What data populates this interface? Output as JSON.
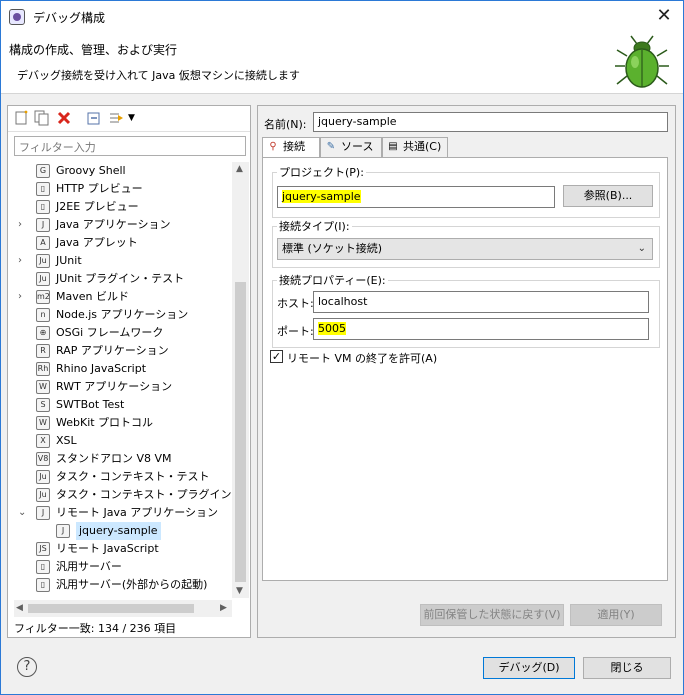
{
  "window": {
    "title": "デバッグ構成",
    "close_glyph": "✕"
  },
  "header": {
    "title": "構成の作成、管理、および実行",
    "description": "デバッグ接続を受け入れて Java 仮想マシンに接続します"
  },
  "left": {
    "filter_placeholder": "フィルター入力",
    "items": [
      {
        "label": "Groovy Shell",
        "icon": "groovy-shell-icon",
        "glyph": "G",
        "indent": 1,
        "expandable": false
      },
      {
        "label": "HTTP プレビュー",
        "icon": "http-preview-icon",
        "glyph": "▯",
        "indent": 1,
        "expandable": false
      },
      {
        "label": "J2EE プレビュー",
        "icon": "j2ee-preview-icon",
        "glyph": "▯",
        "indent": 1,
        "expandable": false
      },
      {
        "label": "Java アプリケーション",
        "icon": "java-application-icon",
        "glyph": "J",
        "indent": 1,
        "expandable": true
      },
      {
        "label": "Java アプレット",
        "icon": "java-applet-icon",
        "glyph": "A",
        "indent": 1,
        "expandable": false
      },
      {
        "label": "JUnit",
        "icon": "junit-icon",
        "glyph": "Ju",
        "indent": 1,
        "expandable": true
      },
      {
        "label": "JUnit プラグイン・テスト",
        "icon": "junit-plugin-test-icon",
        "glyph": "Ju",
        "indent": 1,
        "expandable": false
      },
      {
        "label": "Maven ビルド",
        "icon": "maven-icon",
        "glyph": "m2",
        "indent": 1,
        "expandable": true
      },
      {
        "label": "Node.js アプリケーション",
        "icon": "nodejs-icon",
        "glyph": "n",
        "indent": 1,
        "expandable": false
      },
      {
        "label": "OSGi フレームワーク",
        "icon": "osgi-icon",
        "glyph": "⊕",
        "indent": 1,
        "expandable": false
      },
      {
        "label": "RAP アプリケーション",
        "icon": "rap-icon",
        "glyph": "R",
        "indent": 1,
        "expandable": false
      },
      {
        "label": "Rhino JavaScript",
        "icon": "rhino-icon",
        "glyph": "Rh",
        "indent": 1,
        "expandable": false
      },
      {
        "label": "RWT アプリケーション",
        "icon": "rwt-icon",
        "glyph": "W",
        "indent": 1,
        "expandable": false
      },
      {
        "label": "SWTBot Test",
        "icon": "swtbot-icon",
        "glyph": "S",
        "indent": 1,
        "expandable": false
      },
      {
        "label": "WebKit プロトコル",
        "icon": "webkit-icon",
        "glyph": "W",
        "indent": 1,
        "expandable": false
      },
      {
        "label": "XSL",
        "icon": "xsl-icon",
        "glyph": "X",
        "indent": 1,
        "expandable": false
      },
      {
        "label": "スタンドアロン V8 VM",
        "icon": "v8-icon",
        "glyph": "V8",
        "indent": 1,
        "expandable": false
      },
      {
        "label": "タスク・コンテキスト・テスト",
        "icon": "task-context-test-icon",
        "glyph": "Ju",
        "indent": 1,
        "expandable": false
      },
      {
        "label": "タスク・コンテキスト・プラグイン・テスト",
        "icon": "task-context-plugin-test-icon",
        "glyph": "Ju",
        "indent": 1,
        "expandable": false
      },
      {
        "label": "リモート Java アプリケーション",
        "icon": "remote-java-application-icon",
        "glyph": "J",
        "indent": 1,
        "expandable": true,
        "expanded": true
      },
      {
        "label": "jquery-sample",
        "icon": "remote-config-icon",
        "glyph": "J",
        "indent": 2,
        "expandable": false,
        "selected": true
      },
      {
        "label": "リモート JavaScript",
        "icon": "remote-javascript-icon",
        "glyph": "JS",
        "indent": 1,
        "expandable": false
      },
      {
        "label": "汎用サーバー",
        "icon": "generic-server-icon",
        "glyph": "▯",
        "indent": 1,
        "expandable": false
      },
      {
        "label": "汎用サーバー(外部からの起動)",
        "icon": "generic-server-external-icon",
        "glyph": "▯",
        "indent": 1,
        "expandable": false
      }
    ],
    "filter_status": "フィルター一致: 134 / 236 項目"
  },
  "right": {
    "name_label": "名前(N):",
    "name_value": "jquery-sample",
    "tabs": [
      {
        "label": "接続",
        "icon": "connect-icon",
        "active": true
      },
      {
        "label": "ソース",
        "icon": "source-icon",
        "active": false
      },
      {
        "label": "共通(C)",
        "icon": "common-icon",
        "active": false
      }
    ],
    "project_group": "プロジェクト(P):",
    "project_value": "jquery-sample",
    "browse_button": "参照(B)...",
    "conn_type_group": "接続タイプ(I):",
    "conn_type_value": "標準 (ソケット接続)",
    "conn_props_group": "接続プロパティー(E):",
    "host_label": "ホスト:",
    "host_value": "localhost",
    "port_label": "ポート:",
    "port_value": "5005",
    "allow_terminate_label": "リモート VM の終了を許可(A)",
    "allow_terminate_checked": true,
    "revert_button": "前回保管した状態に戻す(V)",
    "apply_button": "適用(Y)"
  },
  "footer": {
    "debug_button": "デバッグ(D)",
    "close_button": "閉じる"
  }
}
